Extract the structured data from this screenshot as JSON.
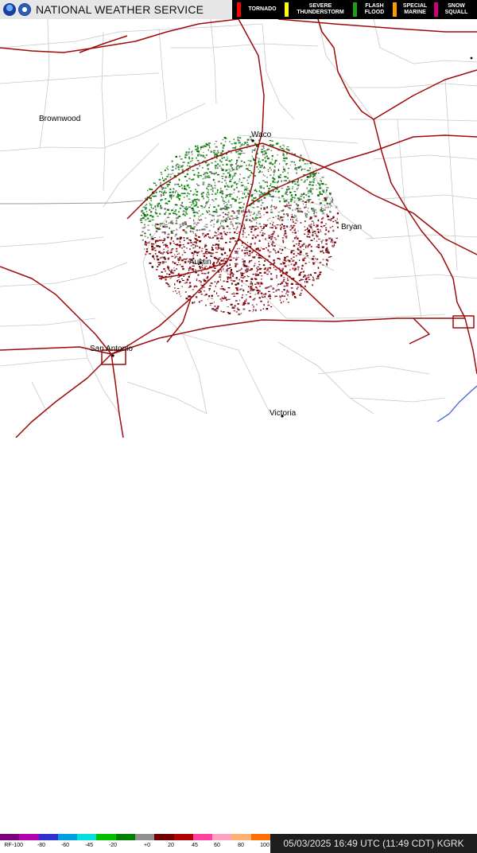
{
  "header": {
    "title": "NATIONAL WEATHER SERVICE",
    "logos": [
      "noaa-logo",
      "nws-logo"
    ]
  },
  "legend": {
    "items": [
      {
        "label": "TORNADO",
        "color": "#ff0000"
      },
      {
        "label": "SEVERE THUNDERSTORM",
        "color": "#ffff00"
      },
      {
        "label": "FLASH FLOOD",
        "color": "#1aa01a"
      },
      {
        "label": "SPECIAL MARINE",
        "color": "#ff9900"
      },
      {
        "label": "SNOW SQUALL",
        "color": "#d0007a"
      }
    ]
  },
  "map": {
    "cities": [
      "Brownwood",
      "Waco",
      "Bryan",
      "Austin",
      "San Antonio",
      "Victoria"
    ],
    "colors": {
      "highway": "#9c0a0a",
      "county": "#c8c8c8",
      "coast": "#3a5ad0"
    }
  },
  "velocity_scale": {
    "prefix": "RF",
    "ticks": [
      "-100",
      "-80",
      "-60",
      "-45",
      "-20",
      "+0",
      "20",
      "45",
      "60",
      "80",
      "100"
    ],
    "colors": [
      "#7a0080",
      "#b000b0",
      "#3030d0",
      "#00a0e0",
      "#00e0e0",
      "#00c000",
      "#008000",
      "#909090",
      "#700000",
      "#b00000",
      "#ff40a0",
      "#ffa0c0",
      "#ffb070",
      "#ff7000"
    ]
  },
  "footer": {
    "timestamp": "05/03/2025 16:49 UTC (11:49 CDT) KGRK"
  }
}
